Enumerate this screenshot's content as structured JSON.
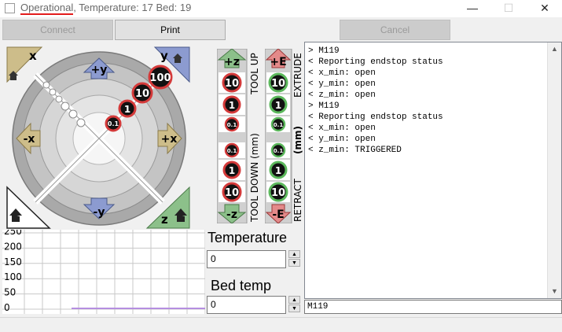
{
  "window": {
    "title_status": "Operational",
    "title_rest": ", Temperature: 17 Bed: 19",
    "minimize_glyph": "—",
    "maximize_glyph": "☐",
    "close_glyph": "✕"
  },
  "toolbar": {
    "connect_label": "Connect",
    "print_label": "Print",
    "cancel_label": "Cancel"
  },
  "jog": {
    "x_home_label": "x",
    "y_home_label": "y",
    "z_home_label": "z",
    "plus_y": "+y",
    "minus_y": "-y",
    "plus_x": "+x",
    "minus_x": "-x",
    "step_100": "100",
    "step_10": "10",
    "step_1": "1",
    "step_01": "0.1"
  },
  "z_column": {
    "up_label": "+z",
    "down_label": "-z",
    "tool_up": "TOOL UP",
    "tool_down": "TOOL DOWN (mm)",
    "steps": [
      "10",
      "1",
      "0.1"
    ]
  },
  "e_column": {
    "extrude_label": "+E",
    "retract_label": "-E",
    "extrude_text": "EXTRUDE",
    "retract_text": "RETRACT",
    "mm_text": "(mm)",
    "steps": [
      "10",
      "1",
      "0.1"
    ]
  },
  "graph": {
    "y_ticks": [
      "250",
      "200",
      "150",
      "100",
      "50",
      "0"
    ],
    "ylim": [
      0,
      250
    ],
    "line_color": "#b58ee0"
  },
  "temperature": {
    "label": "Temperature",
    "value": "0"
  },
  "bed": {
    "label": "Bed temp",
    "value": "0"
  },
  "console": {
    "lines": [
      "> M119",
      "< Reporting endstop status",
      "< x_min: open",
      "< y_min: open",
      "< z_min: open",
      "> M119",
      "< Reporting endstop status",
      "< x_min: open",
      "< y_min: open",
      "< z_min: TRIGGERED"
    ],
    "input_value": "M119"
  },
  "colors": {
    "red_ring": "#d43a3a",
    "green_ring": "#5cb85c",
    "tan_button": "#cdbd8a",
    "blue_button": "#8c9bd0",
    "green_button": "#8cc08a"
  }
}
